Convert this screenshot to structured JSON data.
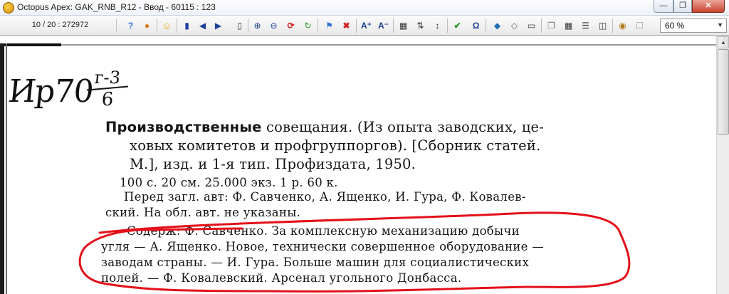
{
  "window": {
    "title": "Octopus Apex: GAK_RNB_R12 - Ввод - 60115 : 123",
    "minimize_icon": "minimize-icon",
    "maximize_icon": "maximize-icon",
    "close_icon": "close-icon"
  },
  "toolbar": {
    "record_counter": "10 / 20 : 272972",
    "zoom": {
      "value": "60 %"
    },
    "icons": [
      "help-icon",
      "user-icon",
      "smiley-icon",
      "page-first-icon",
      "page-prev-icon",
      "page-next-icon",
      "page-last-icon",
      "zoom-in-icon",
      "zoom-out-icon",
      "undo-icon",
      "refresh-icon",
      "pin-icon",
      "delete-icon",
      "font-increase-icon",
      "font-decrease-icon",
      "columns-icon",
      "split-icon",
      "align-icon",
      "check-icon",
      "omega-icon",
      "tag-icon",
      "tag-remove-icon",
      "eraser-icon",
      "copy-icon",
      "grid-icon",
      "list-icon",
      "layout-icon",
      "scroll-icon",
      "bookmark-icon"
    ]
  },
  "document": {
    "shelfmark": {
      "prefix": "Ир70",
      "numerator": "г-3",
      "denominator": "6"
    },
    "lines": [
      {
        "bold": "Производственные",
        "text": " совещания. (Из опыта заводских, це-"
      },
      {
        "text": "ховых комитетов и профгруппоргов). [Сборник статей."
      },
      {
        "text": "М.], изд. и 1-я тип. Профиздата, 1950."
      },
      {
        "text": "100 с.   20 см.   25.000 экз. 1 р. 60 к."
      },
      {
        "text": "Перед загл. авт: Ф. Савченко, А. Ященко, И. Гура, Ф. Ковалев-"
      },
      {
        "text": "ский. На обл. авт. не указаны."
      },
      {
        "text": "Содерж: Ф. Савченко. За комплексную механизацию добычи"
      },
      {
        "text": "угля — А. Ященко. Новое, технически совершенное оборудование —"
      },
      {
        "text": "заводам страны. — И. Гура. Больше машин для социалистических"
      },
      {
        "text": "полей. — Ф. Ковалевский. Арсенал угольного Донбасса."
      }
    ]
  },
  "annotation": {
    "color": "#e3101a"
  }
}
